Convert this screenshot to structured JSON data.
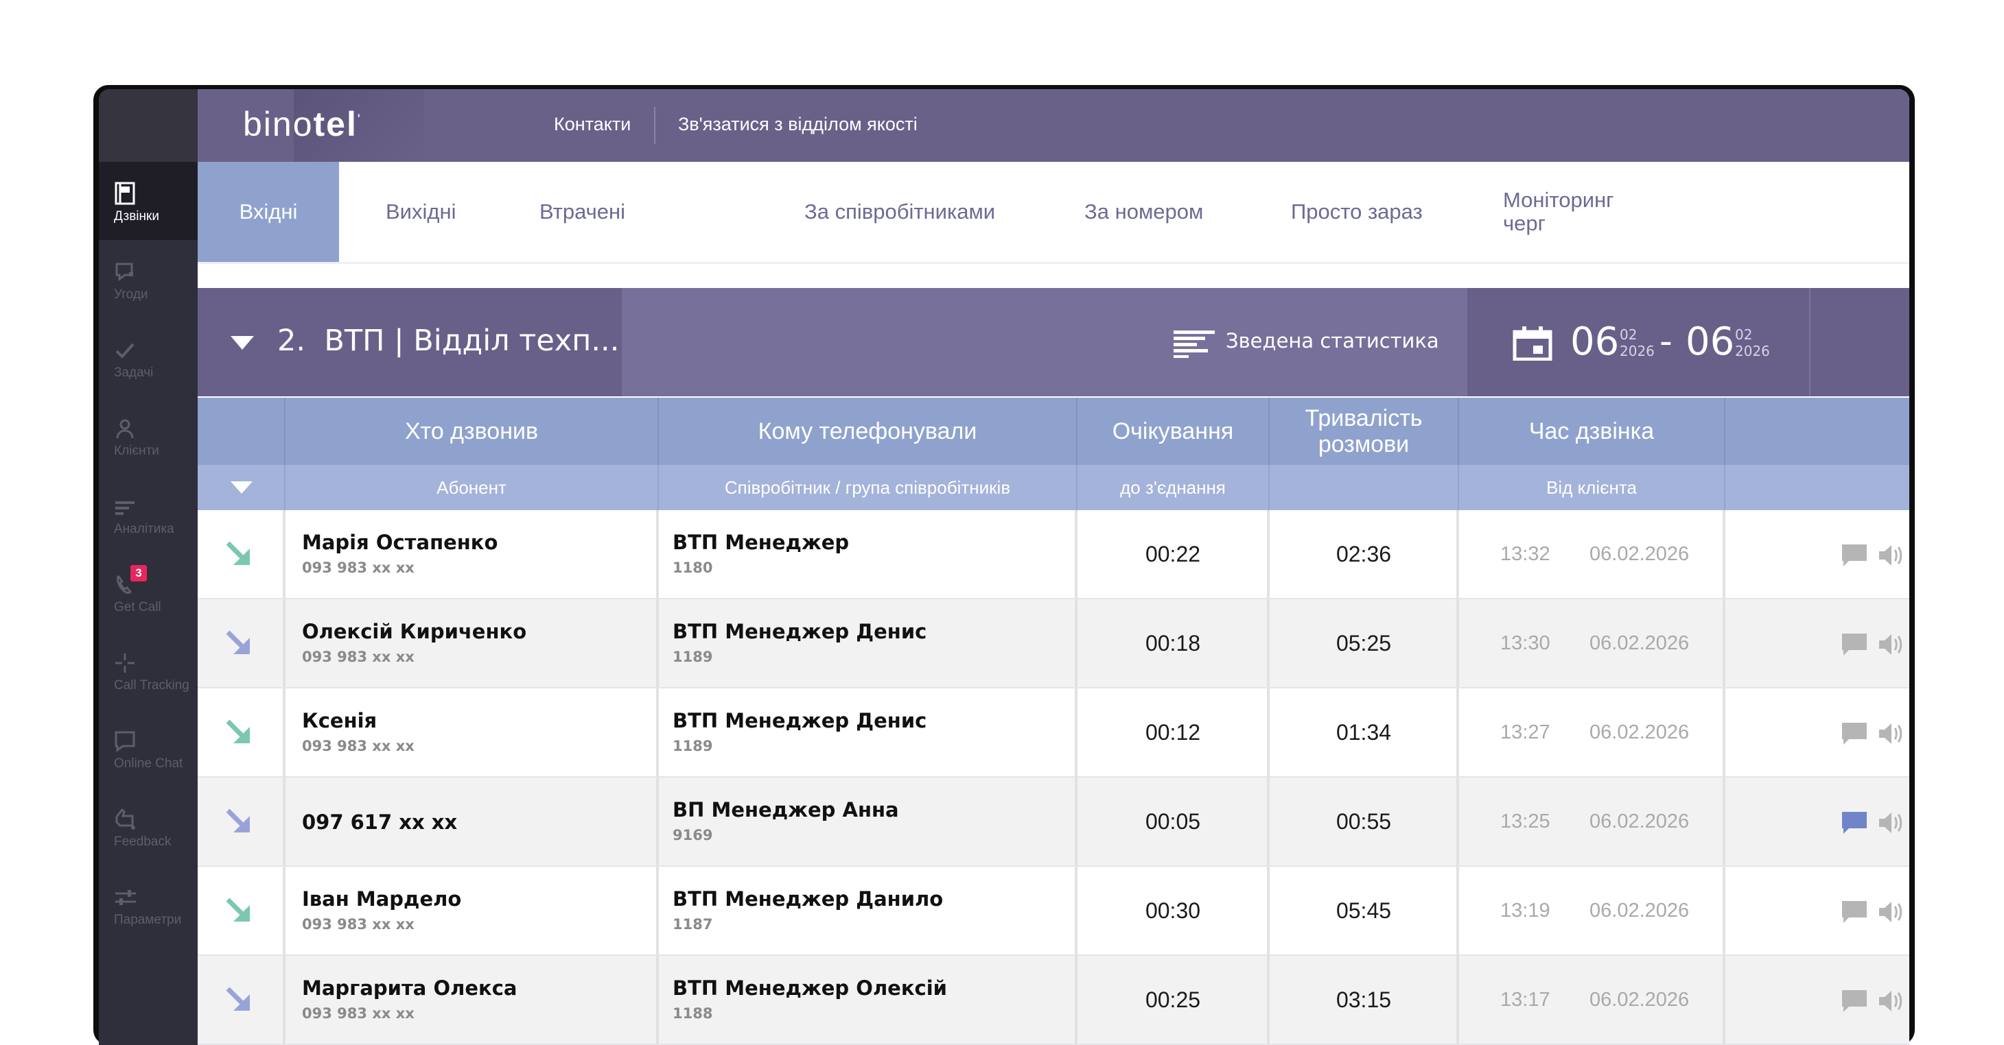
{
  "app": {
    "logo_light": "bino",
    "logo_bold": "tel",
    "logo_mark": "'"
  },
  "topbar": {
    "links": [
      "Контакти",
      "Зв'язатися з відділом якості"
    ]
  },
  "sidebar": {
    "items": [
      {
        "label": "Дзвінки",
        "icon": "calls-icon",
        "active": true
      },
      {
        "label": "Угоди",
        "icon": "deals-icon"
      },
      {
        "label": "Задачі",
        "icon": "check-icon"
      },
      {
        "label": "Клієнти",
        "icon": "user-icon"
      },
      {
        "label": "Аналітика",
        "icon": "analytics-icon"
      },
      {
        "label": "Get Call",
        "icon": "phone-icon",
        "badge": "3"
      },
      {
        "label": "Call Tracking",
        "icon": "crosshair-icon"
      },
      {
        "label": "Online Chat",
        "icon": "chat-icon"
      },
      {
        "label": "Feedback",
        "icon": "feedback-icon"
      },
      {
        "label": "Параметри",
        "icon": "sliders-icon"
      }
    ]
  },
  "tabs": [
    {
      "label": "Вхідні",
      "active": true
    },
    {
      "label": "Вихідні"
    },
    {
      "label": "Втрачені"
    },
    {
      "label": "За співробітниками"
    },
    {
      "label": "За номером"
    },
    {
      "label": "Просто зараз"
    },
    {
      "label": "Моніторинг черг"
    }
  ],
  "filter": {
    "group_number": "2.",
    "group_name": "ВТП | Відділ техп...",
    "summary_label": "Зведена статистика",
    "date_from": {
      "day": "06",
      "month": "02",
      "year": "2026"
    },
    "date_to": {
      "day": "06",
      "month": "02",
      "year": "2026"
    },
    "date_separator": "-"
  },
  "table": {
    "headers": [
      "Хто дзвонив",
      "Кому телефонували",
      "Очікування",
      "Тривалість розмови",
      "Час дзвінка"
    ],
    "subheaders": [
      "Абонент",
      "Співробітник / група співробітників",
      "до з'єднання",
      "",
      "Від клієнта"
    ],
    "rows": [
      {
        "direction": "incoming-accepted",
        "caller": "Марія Остапенко",
        "caller_phone": "093 983 xx xx",
        "employee": "ВТП Менеджер",
        "ext": "1180",
        "wait": "00:22",
        "duration": "02:36",
        "time": "13:32",
        "date": "06.02.2026",
        "comment_active": false
      },
      {
        "direction": "incoming-other",
        "caller": "Олексій Кириченко",
        "caller_phone": "093 983 xx xx",
        "employee": "ВТП Менеджер Денис",
        "ext": "1189",
        "wait": "00:18",
        "duration": "05:25",
        "time": "13:30",
        "date": "06.02.2026",
        "comment_active": false
      },
      {
        "direction": "incoming-accepted",
        "caller": "Ксенія",
        "caller_phone": "093 983 xx xx",
        "employee": "ВТП Менеджер Денис",
        "ext": "1189",
        "wait": "00:12",
        "duration": "01:34",
        "time": "13:27",
        "date": "06.02.2026",
        "comment_active": false
      },
      {
        "direction": "incoming-other",
        "caller": "097 617 xx xx",
        "caller_phone": "",
        "employee": "ВП Менеджер Анна",
        "ext": "9169",
        "wait": "00:05",
        "duration": "00:55",
        "time": "13:25",
        "date": "06.02.2026",
        "comment_active": true
      },
      {
        "direction": "incoming-accepted",
        "caller": "Іван Мардело",
        "caller_phone": "093 983 xx xx",
        "employee": "ВТП Менеджер Данило",
        "ext": "1187",
        "wait": "00:30",
        "duration": "05:45",
        "time": "13:19",
        "date": "06.02.2026",
        "comment_active": false
      },
      {
        "direction": "incoming-other",
        "caller": "Маргарита Олекса",
        "caller_phone": "093 983 xx xx",
        "employee": "ВТП Менеджер Олексій",
        "ext": "1188",
        "wait": "00:25",
        "duration": "03:15",
        "time": "13:17",
        "date": "06.02.2026",
        "comment_active": false
      }
    ]
  },
  "colors": {
    "accent_teal": "#7cc7b2",
    "accent_lavender": "#9aa3d8",
    "comment_active": "#6f85c8",
    "icon_gray": "#b5b5b5"
  }
}
